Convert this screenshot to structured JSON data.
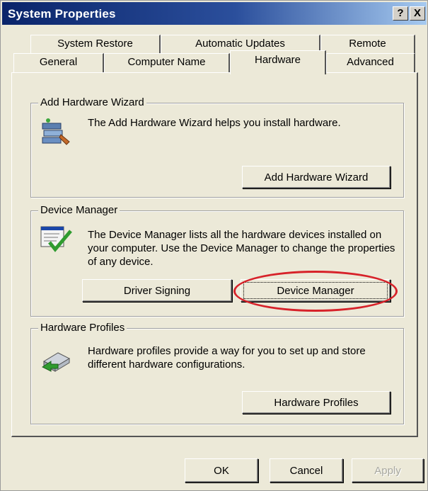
{
  "window": {
    "title": "System Properties",
    "help_button": "?",
    "close_button": "X"
  },
  "tabs": {
    "row_back": [
      "System Restore",
      "Automatic Updates",
      "Remote"
    ],
    "row_front": [
      "General",
      "Computer Name",
      "Hardware",
      "Advanced"
    ],
    "active": "Hardware"
  },
  "add_hardware": {
    "group_title": "Add Hardware Wizard",
    "description": "The Add Hardware Wizard helps you install hardware.",
    "button_label": "Add Hardware Wizard",
    "icon": "add-hardware-icon"
  },
  "device_manager": {
    "group_title": "Device Manager",
    "description": "The Device Manager lists all the hardware devices installed on your computer. Use the Device Manager to change the properties of any device.",
    "driver_signing_label": "Driver Signing",
    "device_manager_label": "Device Manager",
    "icon": "device-manager-icon",
    "highlight_color": "#d7222a"
  },
  "hardware_profiles": {
    "group_title": "Hardware Profiles",
    "description": "Hardware profiles provide a way for you to set up and store different hardware configurations.",
    "button_label": "Hardware Profiles",
    "icon": "hardware-profiles-icon"
  },
  "footer": {
    "ok_label": "OK",
    "cancel_label": "Cancel",
    "apply_label": "Apply"
  }
}
